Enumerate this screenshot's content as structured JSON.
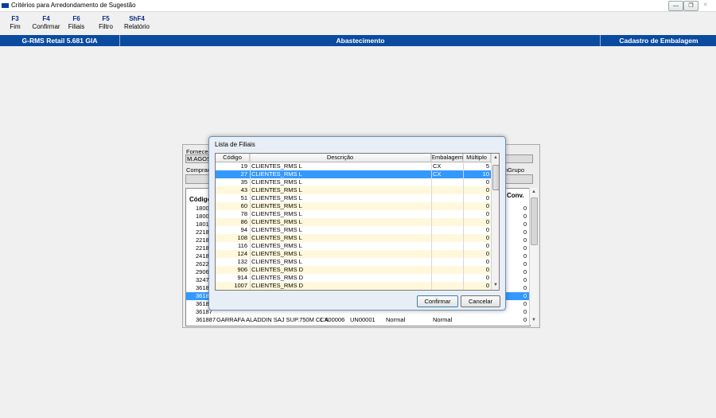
{
  "window": {
    "title": "Critérios para Arredondamento de Sugestão"
  },
  "toolbar": [
    {
      "key": "F3",
      "label": "Fim"
    },
    {
      "key": "F4",
      "label": "Confirmar"
    },
    {
      "key": "F6",
      "label": "Filiais"
    },
    {
      "key": "F5",
      "label": "Filtro"
    },
    {
      "key": "ShF4",
      "label": "Relatório"
    }
  ],
  "header": {
    "app": "G-RMS Retail 5.681 GIA",
    "module": "Abastecimento",
    "screen": "Cadastro de Embalagem"
  },
  "background_form": {
    "fornecedor_label": "Forneced",
    "fornecedor_value": "M.AGOST",
    "comprador_label": "Comprado",
    "grupo_label": "nGrupo",
    "codigo_header": "Código",
    "conv_header": "Conv.",
    "codes": [
      "18007",
      "18008",
      "18010",
      "22182",
      "22183",
      "22185",
      "24189",
      "26229",
      "29061",
      "32470",
      "36184",
      "3618",
      "36186",
      "36187",
      "361887",
      "36"
    ],
    "conv": [
      "0",
      "0",
      "0",
      "0",
      "0",
      "0",
      "0",
      "0",
      "0",
      "0",
      "0",
      "0",
      "0",
      "0",
      "0",
      "0"
    ],
    "selected_index": 11,
    "last_row": {
      "code": "361887",
      "desc": "GARRAFA ALADDIN SAJ SUP.750M CL A",
      "emb1": "CX00006",
      "emb2": "UN00001",
      "tipo1": "Normal",
      "tipo2": "Normal",
      "conv": "0"
    }
  },
  "dialog": {
    "title": "Lista de Filiais",
    "columns": {
      "codigo": "Código",
      "descricao": "Descrição",
      "embalagem": "Embalagem",
      "multiplo": "Múltiplo"
    },
    "rows": [
      {
        "codigo": "19",
        "descricao": "CLIENTES_RMS     L",
        "embalagem": "CX",
        "multiplo": "5"
      },
      {
        "codigo": "27",
        "descricao": "CLIENTES_RMS     L",
        "embalagem": "CX",
        "multiplo": "10"
      },
      {
        "codigo": "35",
        "descricao": "CLIENTES_RMS     L",
        "embalagem": "",
        "multiplo": "0"
      },
      {
        "codigo": "43",
        "descricao": "CLIENTES_RMS     L",
        "embalagem": "",
        "multiplo": "0"
      },
      {
        "codigo": "51",
        "descricao": "CLIENTES_RMS     L",
        "embalagem": "",
        "multiplo": "0"
      },
      {
        "codigo": "60",
        "descricao": "CLIENTES_RMS     L",
        "embalagem": "",
        "multiplo": "0"
      },
      {
        "codigo": "78",
        "descricao": "CLIENTES_RMS     L",
        "embalagem": "",
        "multiplo": "0"
      },
      {
        "codigo": "86",
        "descricao": "CLIENTES_RMS     L",
        "embalagem": "",
        "multiplo": "0"
      },
      {
        "codigo": "94",
        "descricao": "CLIENTES_RMS     L",
        "embalagem": "",
        "multiplo": "0"
      },
      {
        "codigo": "108",
        "descricao": "CLIENTES_RMS     L",
        "embalagem": "",
        "multiplo": "0"
      },
      {
        "codigo": "116",
        "descricao": "CLIENTES_RMS     L",
        "embalagem": "",
        "multiplo": "0"
      },
      {
        "codigo": "124",
        "descricao": "CLIENTES_RMS     L",
        "embalagem": "",
        "multiplo": "0"
      },
      {
        "codigo": "132",
        "descricao": "CLIENTES_RMS     L",
        "embalagem": "",
        "multiplo": "0"
      },
      {
        "codigo": "906",
        "descricao": "CLIENTES_RMS     D",
        "embalagem": "",
        "multiplo": "0"
      },
      {
        "codigo": "914",
        "descricao": "CLIENTES_RMS     D",
        "embalagem": "",
        "multiplo": "0"
      },
      {
        "codigo": "1007",
        "descricao": "CLIENTES_RMS     D",
        "embalagem": "",
        "multiplo": "0"
      }
    ],
    "selected_index": 1,
    "confirm_label": "Confirmar",
    "cancel_label": "Cancelar"
  },
  "colors": {
    "header_bg": "#0a4ba0",
    "selection": "#3399ff",
    "row_alt": "#fff8dc"
  }
}
